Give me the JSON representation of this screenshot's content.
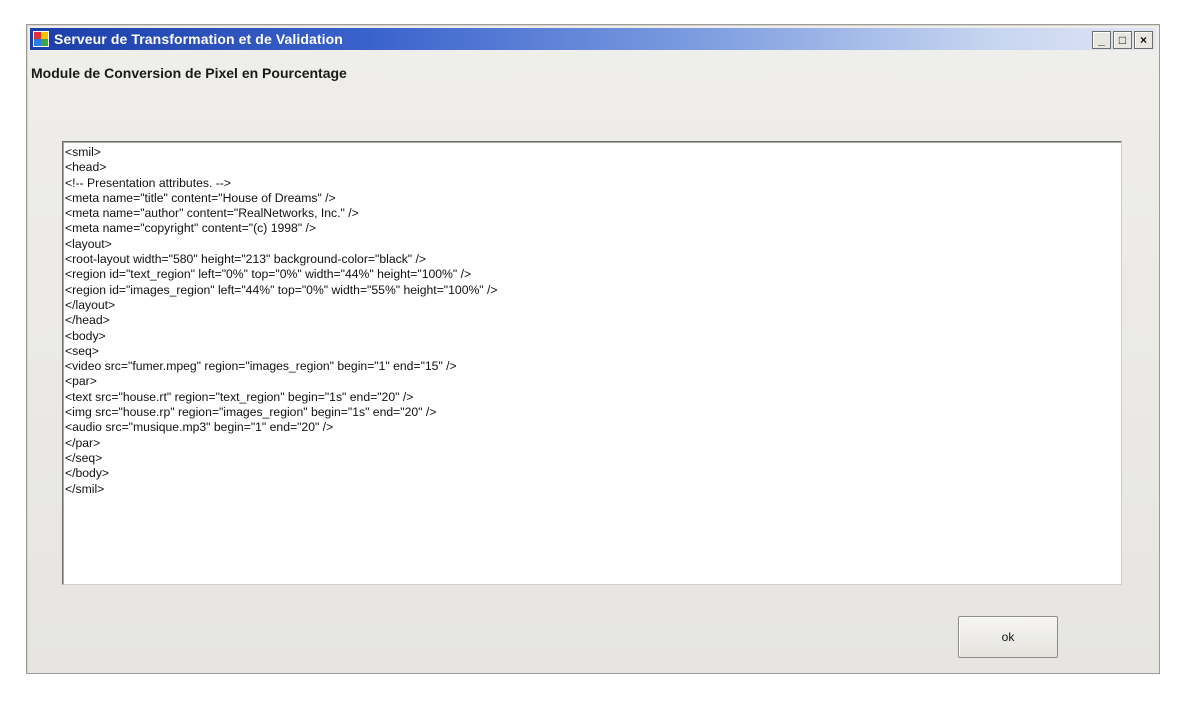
{
  "window": {
    "title": "Serveur de Transformation et de Validation",
    "controls": {
      "minimize": "_",
      "maximize": "□",
      "close": "×"
    }
  },
  "module_title": "Module de Conversion de Pixel en Pourcentage",
  "editor": {
    "lines": [
      "<smil>",
      "<head>",
      "<!-- Presentation attributes. -->",
      "<meta name=\"title\" content=\"House of Dreams\" />",
      "<meta name=\"author\" content=\"RealNetworks, Inc.\" />",
      "<meta name=\"copyright\" content=\"(c) 1998\" />",
      "<layout>",
      "<root-layout width=\"580\" height=\"213\" background-color=\"black\" />",
      "<region id=\"text_region\" left=\"0%\" top=\"0%\" width=\"44%\" height=\"100%\" />",
      "<region id=\"images_region\" left=\"44%\" top=\"0%\" width=\"55%\" height=\"100%\" />",
      "</layout>",
      "</head>",
      "<body>",
      "<seq>",
      "<video src=\"fumer.mpeg\" region=\"images_region\" begin=\"1\" end=\"15\" />",
      "<par>",
      "<text src=\"house.rt\" region=\"text_region\" begin=\"1s\" end=\"20\" />",
      "<img src=\"house.rp\" region=\"images_region\" begin=\"1s\" end=\"20\" />",
      "<audio src=\"musique.mp3\" begin=\"1\" end=\"20\" />",
      "</par>",
      "</seq>",
      "</body>",
      "</smil>"
    ]
  },
  "buttons": {
    "ok_label": "ok"
  },
  "colors": {
    "titlebar_start": "#1c3ea8",
    "titlebar_end": "#dfe6f6",
    "window_bg": "#efeeea"
  }
}
